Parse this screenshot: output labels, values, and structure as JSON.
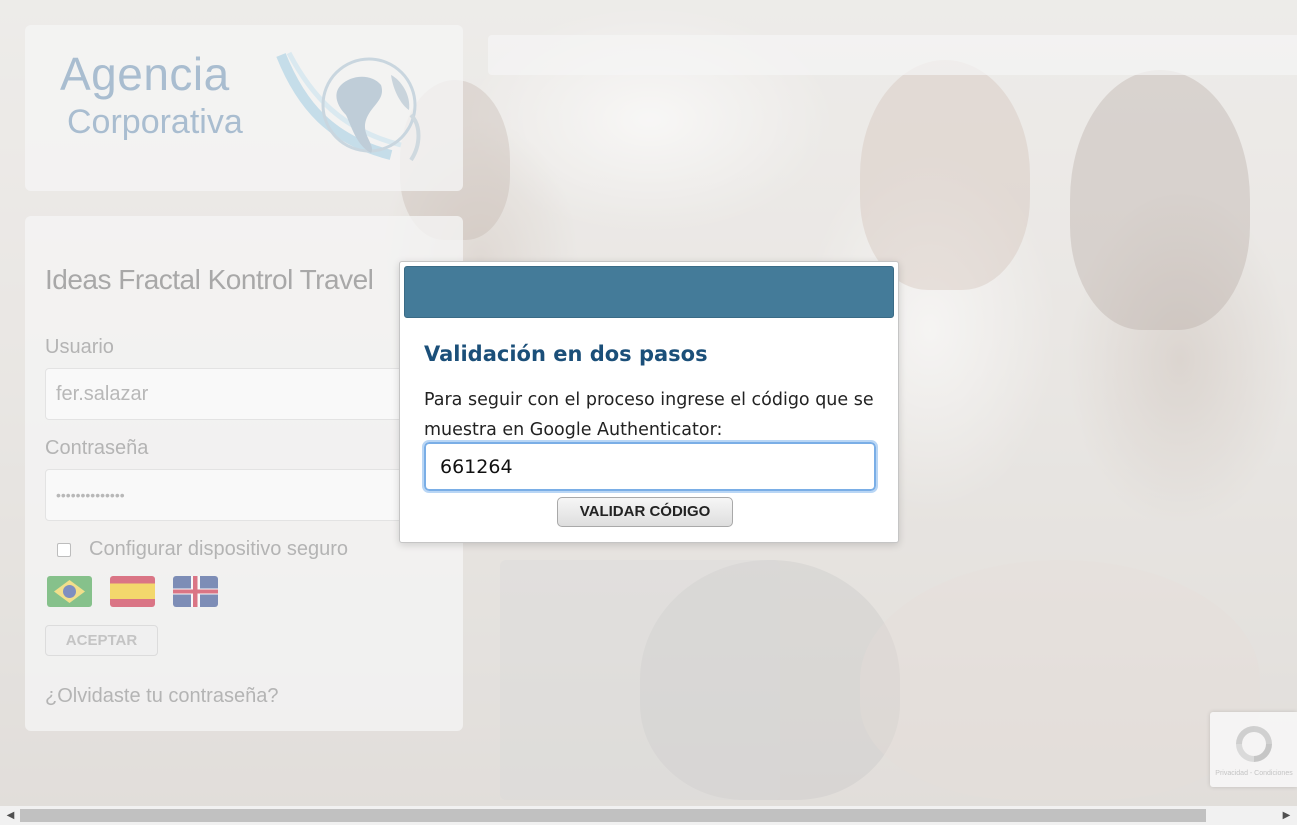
{
  "logo": {
    "line1": "Agencia",
    "line2": "Corporativa"
  },
  "login": {
    "title": "Ideas Fractal Kontrol Travel",
    "user_label": "Usuario",
    "user_value": "fer.salazar",
    "password_label": "Contraseña",
    "password_value": "••••••••••••••",
    "secure_device_label": "Configurar dispositivo seguro",
    "secure_device_checked": false,
    "languages": [
      "pt-BR",
      "es",
      "en"
    ],
    "accept_label": "ACEPTAR",
    "forgot_label": "¿Olvidaste tu contraseña?"
  },
  "modal": {
    "title": "Validación en dos pasos",
    "text": "Para seguir con el proceso ingrese el código que se muestra en Google Authenticator:",
    "code_value": "661264",
    "validate_label": "VALIDAR CÓDIGO",
    "header_color": "#447b99"
  },
  "recaptcha": {
    "text": "Privacidad - Condiciones"
  },
  "scrollbar": {
    "left_arrow": "◀",
    "right_arrow": "▶"
  }
}
